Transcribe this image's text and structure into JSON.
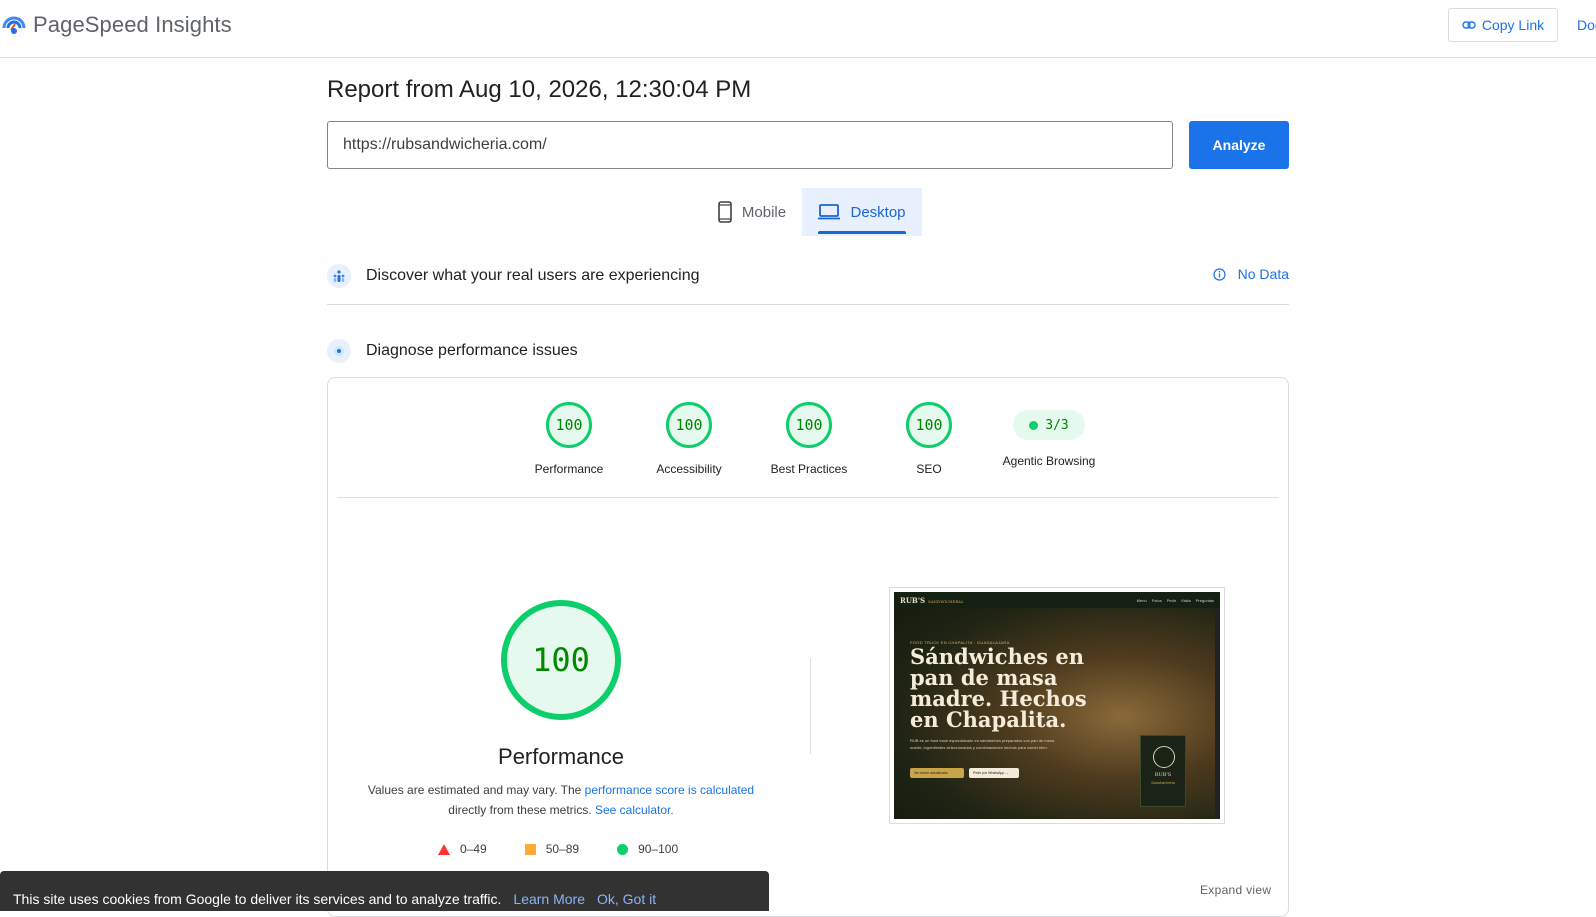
{
  "header": {
    "brand": "PageSpeed Insights",
    "copy_link": "Copy Link",
    "docs": "Docs"
  },
  "report": {
    "title": "Report from Aug 10, 2026, 12:30:04 PM",
    "url_value": "https://rubsandwicheria.com/",
    "analyze_label": "Analyze"
  },
  "tabs": [
    {
      "label": "Mobile",
      "active": false
    },
    {
      "label": "Desktop",
      "active": true
    }
  ],
  "field_data": {
    "title": "Discover what your real users are experiencing",
    "status": "No Data"
  },
  "diagnose": {
    "title": "Diagnose performance issues"
  },
  "scores": [
    {
      "label": "Performance",
      "value": "100"
    },
    {
      "label": "Accessibility",
      "value": "100"
    },
    {
      "label": "Best Practices",
      "value": "100"
    },
    {
      "label": "SEO",
      "value": "100"
    }
  ],
  "agentic": {
    "label": "Agentic Browsing",
    "value": "3/3"
  },
  "performance": {
    "score": "100",
    "label": "Performance",
    "disclaimer_1": "Values are estimated and may vary. The ",
    "disclaimer_link1": "performance score is calculated",
    "disclaimer_2": " directly from these metrics. ",
    "disclaimer_link2": "See calculator."
  },
  "legend": [
    {
      "range": "0–49",
      "color": "#ff3333"
    },
    {
      "range": "50–89",
      "color": "#ffaa33"
    },
    {
      "range": "90–100",
      "color": "#0cce6b"
    }
  ],
  "thumbnail": {
    "brand": "RUB'S",
    "brand_sub": "SANDWICHERIA",
    "nav_links": [
      "Menú",
      "Fotos",
      "Pedir",
      "Visita",
      "Preguntas"
    ],
    "kicker": "FOOD TRUCK EN CHAPALITA · GUADALAJARA",
    "headline": "Sándwiches en pan de masa madre. Hechos en Chapalita.",
    "sub": "RUB es un food truck especializado en sándwiches preparados con pan de masa madre, ingredientes seleccionados y combinaciones hechas para comer bien.",
    "btn1": "Ver menú actualizado",
    "btn2": "Pedir por WhatsApp →",
    "badge_name": "RUB'S",
    "badge_sub": "Sandwicheria"
  },
  "expand_view": "Expand view",
  "cookie": {
    "text": "This site uses cookies from Google to deliver its services and to analyze traffic.",
    "learn_more": "Learn More",
    "ok": "Ok, Got it"
  },
  "colors": {
    "accent": "#1a73e8",
    "pass": "#0cce6b"
  }
}
